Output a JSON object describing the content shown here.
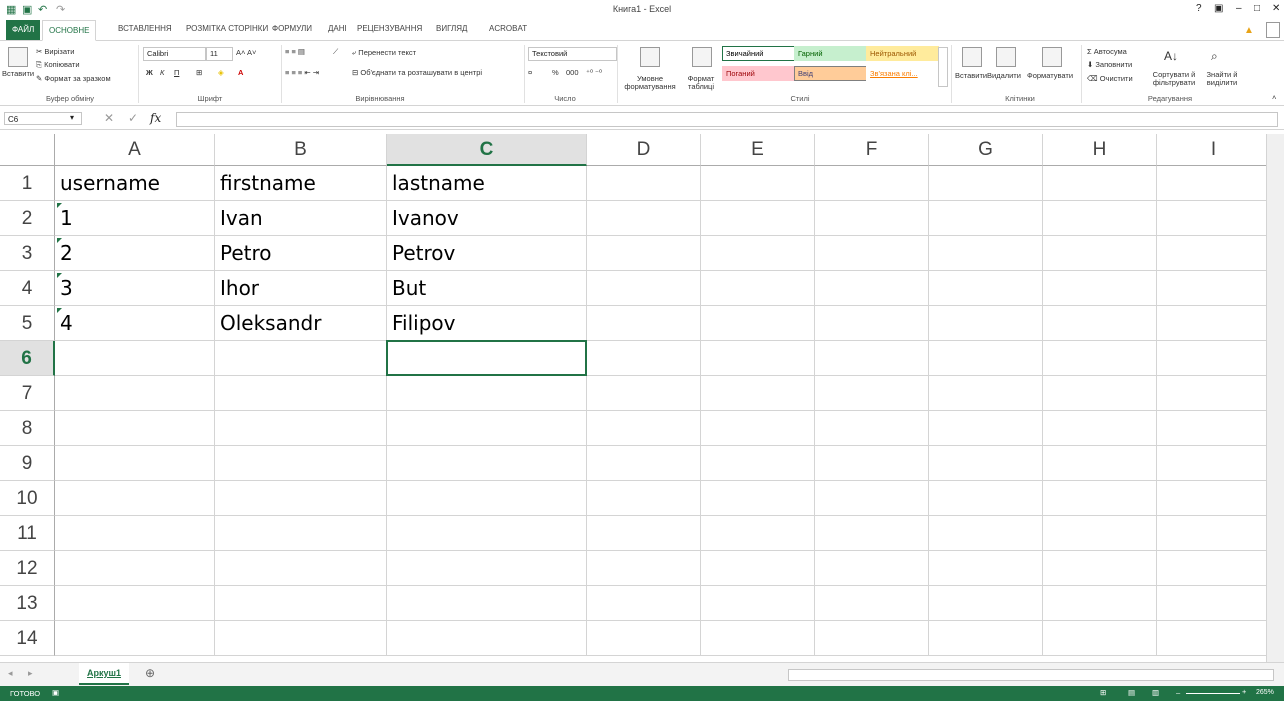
{
  "window": {
    "title": "Книга1 - Excel"
  },
  "title_controls": [
    "?",
    "▣",
    "–",
    "□",
    "✕"
  ],
  "tabs": {
    "file": "ФАЙЛ",
    "items": [
      "ОСНОВНЕ",
      "ВСТАВЛЕННЯ",
      "РОЗМІТКА СТОРІНКИ",
      "ФОРМУЛИ",
      "ДАНІ",
      "РЕЦЕНЗУВАННЯ",
      "ВИГЛЯД",
      "ACROBAT"
    ]
  },
  "ribbon": {
    "clipboard": {
      "paste": "Вставити",
      "cut": "Вирізати",
      "copy": "Копіювати",
      "format_painter": "Формат за зразком",
      "label": "Буфер обміну"
    },
    "font": {
      "name": "Calibri",
      "size": "11",
      "bold": "Ж",
      "italic": "К",
      "underline": "П",
      "label": "Шрифт"
    },
    "alignment": {
      "wrap": "Перенести текст",
      "merge": "Об'єднати та розташувати в центрі",
      "label": "Вирівнювання"
    },
    "number": {
      "format": "Текстовий",
      "percent": "%",
      "thousands": "000",
      "label": "Число"
    },
    "styles": {
      "conditional": "Умовне форматування",
      "as_table": "Формат таблиці",
      "items": [
        {
          "name": "Звичайний",
          "bg": "#ffffff",
          "fg": "#000000"
        },
        {
          "name": "Гарний",
          "bg": "#c6efce",
          "fg": "#006100"
        },
        {
          "name": "Нейтральний",
          "bg": "#ffeb9c",
          "fg": "#9c5700"
        },
        {
          "name": "Поганий",
          "bg": "#ffc7ce",
          "fg": "#9c0006"
        },
        {
          "name": "Ввід",
          "bg": "#ffcc99",
          "fg": "#3f3f76"
        },
        {
          "name": "Зв'язана клі...",
          "bg": "#ffffff",
          "fg": "#fa7d00"
        }
      ],
      "label": "Стилі"
    },
    "cells": {
      "insert": "Вставити",
      "delete": "Видалити",
      "format": "Форматувати",
      "label": "Клітинки"
    },
    "editing": {
      "autosum": "Автосума",
      "fill": "Заповнити",
      "clear": "Очистити",
      "sort": "Сортувати й фільтрувати",
      "find": "Знайти й виділити",
      "label": "Редагування"
    }
  },
  "formula_bar": {
    "name_box": "C6",
    "fx": "fx",
    "value": ""
  },
  "sheet": {
    "columns": [
      "A",
      "B",
      "C",
      "D",
      "E",
      "F",
      "G",
      "H",
      "I"
    ],
    "selected_column": "C",
    "rows": [
      "1",
      "2",
      "3",
      "4",
      "5",
      "6",
      "7",
      "8",
      "9",
      "10",
      "11",
      "12",
      "13",
      "14"
    ],
    "selected_row": "6",
    "cells": [
      [
        "username",
        "firstname",
        "lastname"
      ],
      [
        "1",
        "Ivan",
        "Ivanov"
      ],
      [
        "2",
        "Petro",
        "Petrov"
      ],
      [
        "3",
        "Ihor",
        "But"
      ],
      [
        "4",
        "Oleksandr",
        "Filipov"
      ]
    ]
  },
  "sheet_tabs": {
    "active": "Аркуш1",
    "add": "⊕"
  },
  "status": {
    "ready": "ГОТОВО",
    "zoom": "265%"
  },
  "colors": {
    "accent": "#217346"
  }
}
